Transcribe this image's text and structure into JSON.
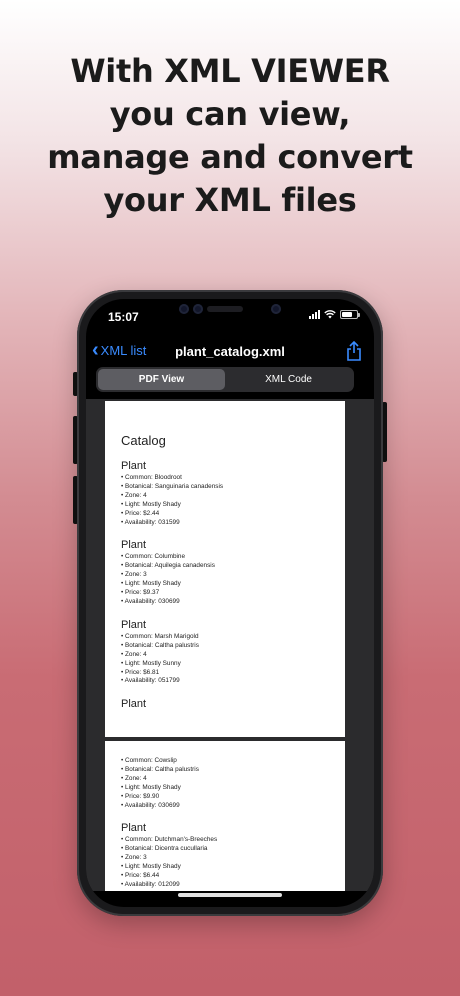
{
  "headline": {
    "lines": [
      "With XML VIEWER",
      "you can view,",
      "manage and convert",
      "your XML files"
    ]
  },
  "status_bar": {
    "time": "15:07"
  },
  "nav": {
    "back_label": "XML list",
    "title": "plant_catalog.xml"
  },
  "tabs": [
    {
      "label": "PDF View",
      "active": true
    },
    {
      "label": "XML Code",
      "active": false
    }
  ],
  "document": {
    "title": "Catalog",
    "page1_plants": [
      {
        "heading": "Plant",
        "fields": [
          "Common: Bloodroot",
          "Botanical: Sanguinaria canadensis",
          "Zone: 4",
          "Light: Mostly Shady",
          "Price: $2.44",
          "Availability: 031599"
        ]
      },
      {
        "heading": "Plant",
        "fields": [
          "Common: Columbine",
          "Botanical: Aquilegia canadensis",
          "Zone: 3",
          "Light: Mostly Shady",
          "Price: $9.37",
          "Availability: 030699"
        ]
      },
      {
        "heading": "Plant",
        "fields": [
          "Common: Marsh Marigold",
          "Botanical: Caltha palustris",
          "Zone: 4",
          "Light: Mostly Sunny",
          "Price: $6.81",
          "Availability: 051799"
        ]
      },
      {
        "heading": "Plant",
        "fields": []
      }
    ],
    "page2_plants": [
      {
        "heading": "",
        "fields": [
          "Common: Cowslip",
          "Botanical: Caltha palustris",
          "Zone: 4",
          "Light: Mostly Shady",
          "Price: $9.90",
          "Availability: 030699"
        ]
      },
      {
        "heading": "Plant",
        "fields": [
          "Common: Dutchman's-Breeches",
          "Botanical: Dicentra cucullaria",
          "Zone: 3",
          "Light: Mostly Shady",
          "Price: $6.44",
          "Availability: 012099"
        ]
      }
    ]
  },
  "colors": {
    "accent": "#3a8bff",
    "page_bg_top": "#ffffff",
    "page_bg_bottom": "#c2606a"
  }
}
